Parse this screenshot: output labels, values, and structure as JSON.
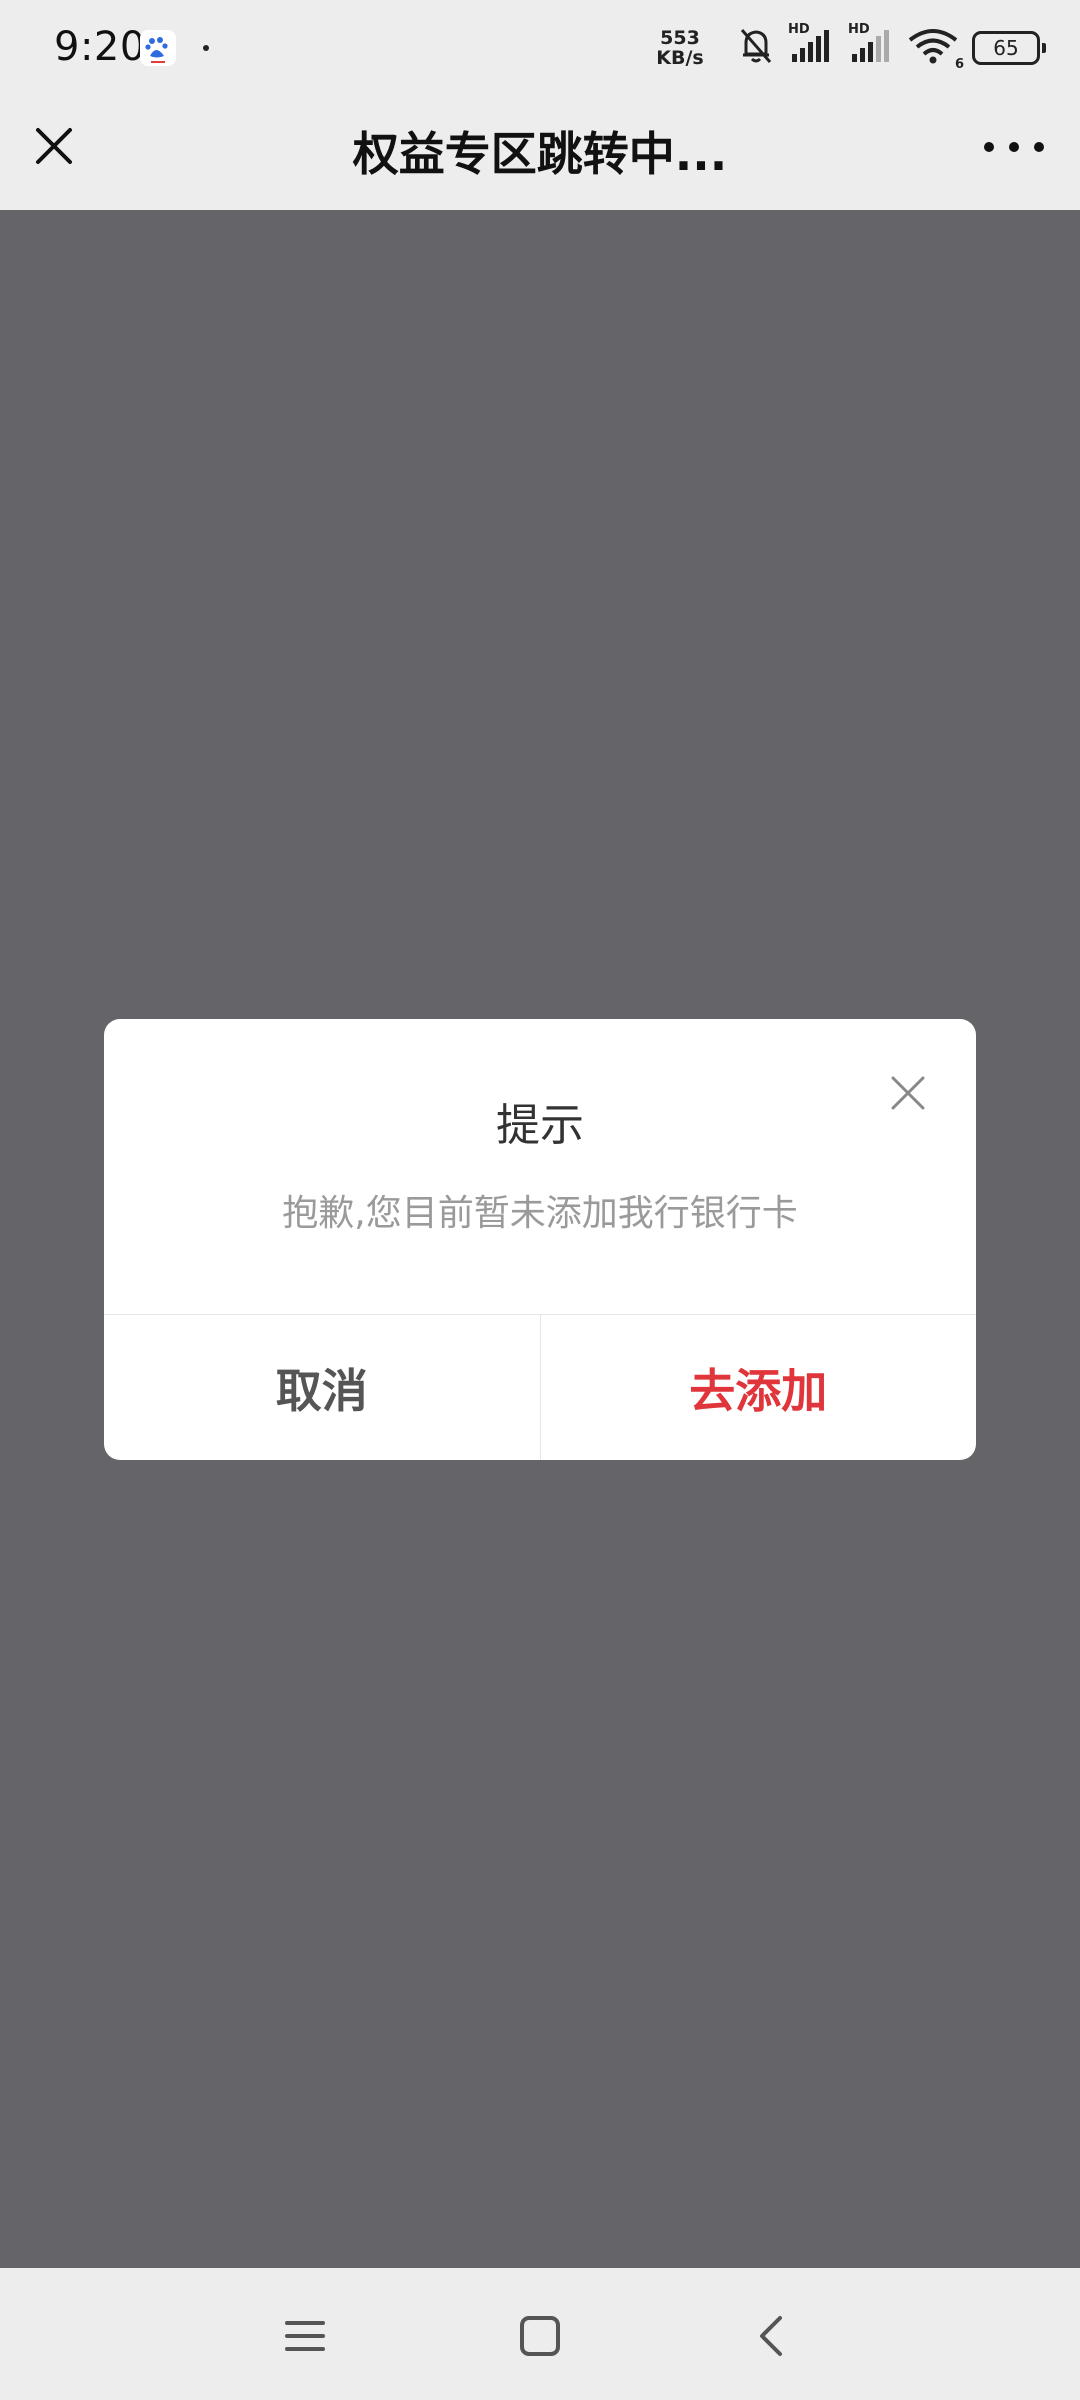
{
  "status_bar": {
    "time": "9:20",
    "net_speed_value": "553",
    "net_speed_unit": "KB/s",
    "signal_label_1": "HD",
    "signal_label_2": "HD",
    "wifi_label": "6",
    "battery": "65"
  },
  "title_bar": {
    "title": "权益专区跳转中..."
  },
  "dialog": {
    "title": "提示",
    "message": "抱歉,您目前暂未添加我行银行卡",
    "cancel_label": "取消",
    "confirm_label": "去添加",
    "confirm_color": "#e0353b"
  },
  "icons": {
    "close_nav": "close-icon",
    "more": "more-dots-icon",
    "dialog_close": "close-icon",
    "nav_menu": "menu-icon",
    "nav_home": "home-square-icon",
    "nav_back": "back-chevron-icon"
  }
}
